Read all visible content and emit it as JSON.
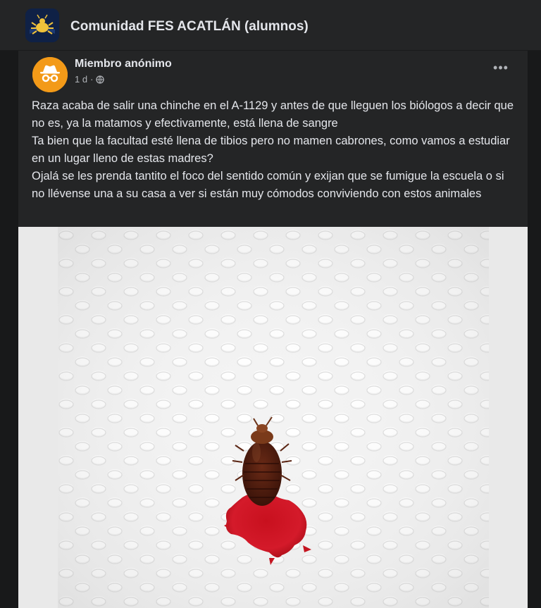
{
  "header": {
    "group_name": "Comunidad FES ACATLÁN (alumnos)",
    "group_avatar_icon": "group-logo-icon"
  },
  "post": {
    "author": "Miembro anónimo",
    "time": "1 d",
    "separator": "·",
    "audience_icon": "globe-icon",
    "more_label": "•••",
    "paragraphs": [
      "Raza acaba de salir una chinche en el A-1129 y antes de que lleguen los biólogos a decir que no es, ya la matamos y efectivamente, está llena de sangre",
      "Ta bien que la facultad esté llena de tibios pero no mamen cabrones, como vamos a estudiar en un lugar lleno de estas madres?",
      "Ojalá se les prenda tantito el foco del sentido común y exijan que se fumigue la escuela o si no llévense una a su casa a ver si están muy cómodos conviviendo con estos animales"
    ]
  },
  "colors": {
    "page_bg": "#18191a",
    "card_bg": "#242526",
    "text_primary": "#e4e6eb",
    "text_secondary": "#b0b3b8",
    "anon_avatar": "#f39a18"
  }
}
